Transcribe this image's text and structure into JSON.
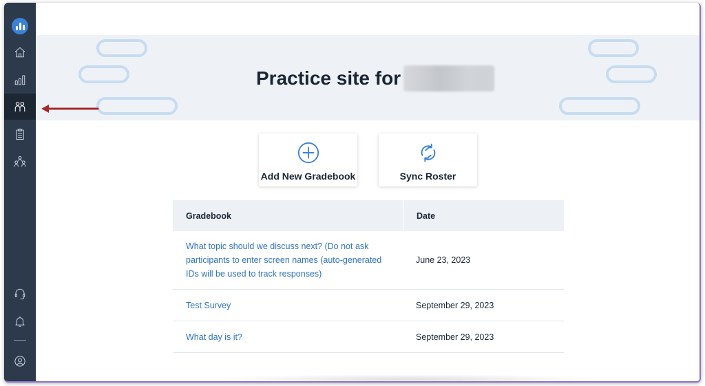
{
  "sidebar": {
    "items": [
      {
        "name": "home",
        "icon": "home-icon"
      },
      {
        "name": "reports",
        "icon": "bar-chart-icon"
      },
      {
        "name": "participants",
        "icon": "people-icon",
        "active": true
      },
      {
        "name": "assignments",
        "icon": "clipboard-icon"
      },
      {
        "name": "groups",
        "icon": "team-icon"
      }
    ],
    "bottom_items": [
      {
        "name": "support",
        "icon": "headset-icon"
      },
      {
        "name": "notifications",
        "icon": "bell-icon"
      },
      {
        "name": "account",
        "icon": "user-circle-icon"
      }
    ]
  },
  "banner": {
    "title": "Practice site for"
  },
  "actions": {
    "add_gradebook": "Add New Gradebook",
    "sync_roster": "Sync Roster"
  },
  "table": {
    "headers": [
      "Gradebook",
      "Date"
    ],
    "rows": [
      {
        "gradebook": "What topic should we discuss next? (Do not ask participants to enter screen names (auto-generated IDs will be used to track responses)",
        "date": "June 23, 2023"
      },
      {
        "gradebook": "Test Survey",
        "date": "September 29, 2023"
      },
      {
        "gradebook": "What day is it?",
        "date": "September 29, 2023"
      }
    ]
  },
  "colors": {
    "sidebar": "#2c3a4c",
    "accent": "#3b82d6",
    "link": "#2f74c0",
    "arrow": "#a52a2a"
  }
}
